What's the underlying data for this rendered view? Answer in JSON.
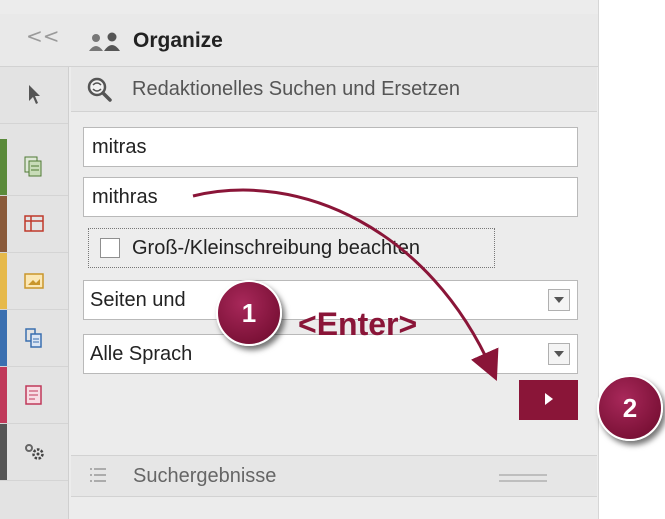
{
  "header": {
    "collapse_label": "<<",
    "icon": "organize-icon",
    "title": "Organize"
  },
  "toolbar": {
    "items": [
      {
        "name": "pointer-tool",
        "icon": "pointer-icon",
        "color": ""
      },
      {
        "name": "pages-tool",
        "icon": "pages-icon",
        "color": "#5a8a3a"
      },
      {
        "name": "table-tool",
        "icon": "table-icon",
        "color": "#8a5a3a"
      },
      {
        "name": "media-tool",
        "icon": "media-icon",
        "color": "#e6b94a"
      },
      {
        "name": "datasource-tool",
        "icon": "datasource-icon",
        "color": "#3a6fb0"
      },
      {
        "name": "templates-tool",
        "icon": "templates-icon",
        "color": "#c0395a"
      },
      {
        "name": "settings-tool",
        "icon": "gears-icon",
        "color": "#555555"
      }
    ]
  },
  "search_panel": {
    "icon": "search-replace-icon",
    "title": "Redaktionelles Suchen und Ersetzen",
    "search_value": "mitras",
    "replace_value": "mithras",
    "case_label": "Groß-/Kleinschreibung beachten",
    "scope_select": "Seiten und",
    "language_select": "Alle Sprach",
    "go_icon": "play-icon"
  },
  "results": {
    "icon": "list-icon",
    "title": "Suchergebnisse"
  },
  "annotations": {
    "step1": "1",
    "step2": "2",
    "enter_label": "<Enter>",
    "accent": "#8a1538"
  }
}
